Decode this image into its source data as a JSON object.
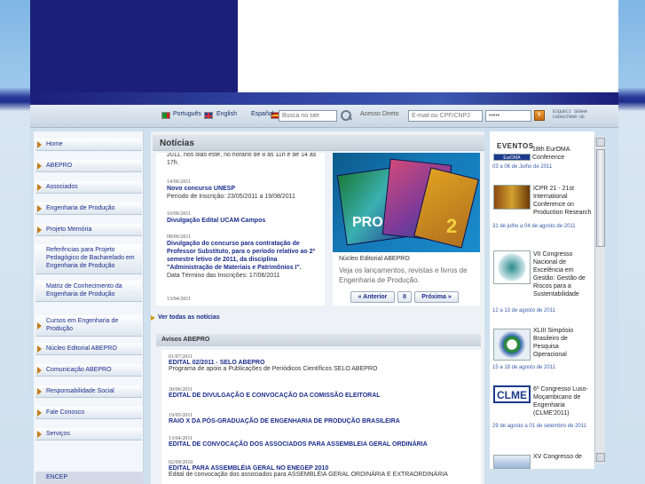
{
  "toolbar": {
    "lang_pt": "Português",
    "lang_en": "English",
    "lang_es": "Español",
    "search_placeholder": "Busca no site",
    "acesso_label": "Acesso Direto",
    "email_placeholder": "E-mail ou CPF/CNPJ",
    "password_value": "•••••",
    "forgot_line1": "ESQUECI SENHA",
    "forgot_line2": "CADASTRAR-SE"
  },
  "sidebar": {
    "items": [
      {
        "label": "Home"
      },
      {
        "label": "ABEPRO"
      },
      {
        "label": "Associados"
      },
      {
        "label": "Engenharia de Produção"
      },
      {
        "label": "Projeto Memória"
      },
      {
        "label": "Referências para Projeto Pedagógico de Bacharelado em Engenharia de Produção"
      },
      {
        "label": "Matriz de Conhecimento da Engenharia de Produção"
      },
      {
        "label": "Cursos em Engenharia de Produção"
      },
      {
        "label": "Núcleo Editorial ABEPRO"
      },
      {
        "label": "Comunicação ABEPRO"
      },
      {
        "label": "Responsabilidade Social"
      },
      {
        "label": "Fale Conosco"
      },
      {
        "label": "Serviços"
      },
      {
        "label": "ENCEP"
      }
    ]
  },
  "noticias": {
    "title": "Notícias",
    "cut_text": "2011, nos dias este, no horário de 8 às 11h e de 14 às 17h.",
    "items": [
      {
        "date": "14/06/2011",
        "title": "Novo concurso UNESP",
        "text": "Período de Inscrição: 23/05/2011 a 19/08/2011"
      },
      {
        "date": "10/06/2011",
        "title": "Divulgação Edital UCAM-Campos",
        "text": ""
      },
      {
        "date": "08/06/2011",
        "title": "Divulgação do concurso para contratação de Professor Substituto, para o período relativo ao 2º semestre letivo de 2011, da disciplina \"Administração de Materiais e Patrimônios I\".",
        "text": "Data Término das Inscrições: 17/06/2011"
      },
      {
        "date": "13/04/2011",
        "title": "",
        "text": ""
      }
    ],
    "ver_todas": "Ver todas as notícias"
  },
  "feature": {
    "book_label": "PRO",
    "book_number": "2",
    "title": "Núcleo Editorial ABEPRO",
    "description": "Veja os lançamentos, revistas e livros de Engenharia de Produção.",
    "prev": "« Anterior",
    "pause": "II",
    "next": "Próxima »"
  },
  "avisos": {
    "title": "Avisos ABEPRO",
    "items": [
      {
        "date": "01/07/2011",
        "title": "EDITAL 02/2011 - SELO ABEPRO",
        "text": "Programa de apoio a Publicações de Periódicos Científicos SELO ABEPRO"
      },
      {
        "date": "30/06/2011",
        "title": "EDITAL DE DIVULGAÇÃO E CONVOCAÇÃO DA COMISSÃO ELEITORAL",
        "text": ""
      },
      {
        "date": "19/05/2011",
        "title": "RAIO X DA PÓS-GRADUAÇÃO DE ENGENHARIA DE PRODUÇÃO BRASILEIRA",
        "text": ""
      },
      {
        "date": "13/04/2011",
        "title": "EDITAL DE CONVOCAÇÃO DOS ASSOCIADOS PARA ASSEMBLEIA GERAL ORDINÁRIA",
        "text": ""
      },
      {
        "date": "02/09/2010",
        "title": "EDITAL PARA ASSEMBLÉIA GERAL NO ENEGEP 2010",
        "text": "Edital de convocação dos associados para ASSEMBLÉIA GERAL ORDINÁRIA E EXTRAORDINÁRIA"
      }
    ]
  },
  "eventos": {
    "title": "EVENTOS",
    "items": [
      {
        "name": "18th EurOMA Conference",
        "date": "03 a 06 de Julho de 2011",
        "logo_text": "EurOMA"
      },
      {
        "name": "ICPR 21 - 21st International Conference on Production Research",
        "date": "31 de julho a 04 de agosto de 2011",
        "logo_text": ""
      },
      {
        "name": "VII Congresso Nacional de Excelência em Gestão: Gestão de Riscos para a Sustentabilidade",
        "date": "12 a 13 de agosto de 2011",
        "logo_text": ""
      },
      {
        "name": "XLIII Simpósio Brasileiro de Pesquisa Operacional",
        "date": "15 a 18 de agosto de 2011",
        "logo_text": ""
      },
      {
        "name": "6º Congresso Luso-Moçambicano de Engenharia (CLME'2011)",
        "date": "29 de agosto a 01 de setembro de 2011",
        "logo_text": "CLME"
      },
      {
        "name": "XV Congresso de",
        "date": "",
        "logo_text": ""
      }
    ]
  }
}
